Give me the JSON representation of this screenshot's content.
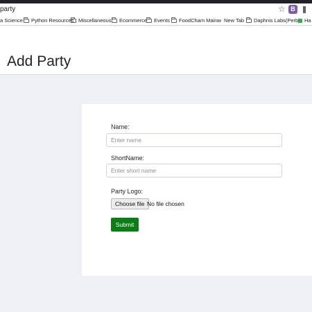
{
  "browser": {
    "url": "party",
    "extension_badge": "B"
  },
  "bookmarks": [
    {
      "label": "a Science",
      "icon": "none"
    },
    {
      "label": "Python Resources",
      "icon": "folder-icon"
    },
    {
      "label": "Miscellaneous",
      "icon": "folder-icon"
    },
    {
      "label": "Ecommerce",
      "icon": "folder-icon"
    },
    {
      "label": "Events",
      "icon": "folder-icon"
    },
    {
      "label": "FoodCham Main",
      "icon": "folder-icon"
    },
    {
      "label": "New Tab",
      "icon": "tab-icon"
    },
    {
      "label": "Daphnis Labs(Perb)",
      "icon": "folder-icon"
    },
    {
      "label": "Ha",
      "icon": "green-icon"
    }
  ],
  "page": {
    "title": "Add Party"
  },
  "form": {
    "name_label": "Name:",
    "name_placeholder": "Enter name",
    "name_value": "",
    "shortname_label": "ShortName:",
    "shortname_placeholder": "Enter short name",
    "shortname_value": "",
    "logo_label": "Party Logo:",
    "choose_file_label": "Choose file",
    "file_status": "No file chosen",
    "submit_label": "Submit"
  },
  "colors": {
    "submit_button": "#0a7d16",
    "page_background": "#eef0f5",
    "extension_badge": "#7b5ea7"
  }
}
